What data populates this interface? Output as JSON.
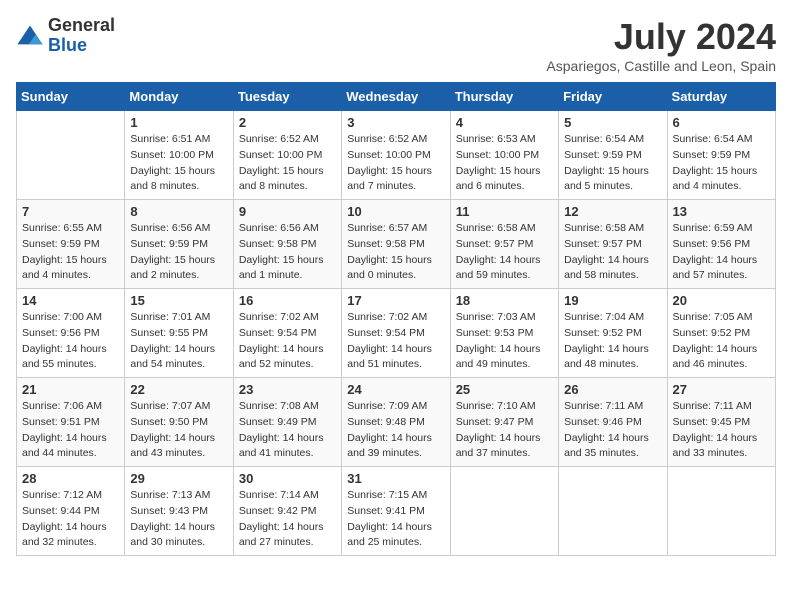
{
  "header": {
    "logo_general": "General",
    "logo_blue": "Blue",
    "month_title": "July 2024",
    "location": "Aspariegos, Castille and Leon, Spain"
  },
  "days_of_week": [
    "Sunday",
    "Monday",
    "Tuesday",
    "Wednesday",
    "Thursday",
    "Friday",
    "Saturday"
  ],
  "weeks": [
    [
      {
        "day": "",
        "info": ""
      },
      {
        "day": "1",
        "info": "Sunrise: 6:51 AM\nSunset: 10:00 PM\nDaylight: 15 hours\nand 8 minutes."
      },
      {
        "day": "2",
        "info": "Sunrise: 6:52 AM\nSunset: 10:00 PM\nDaylight: 15 hours\nand 8 minutes."
      },
      {
        "day": "3",
        "info": "Sunrise: 6:52 AM\nSunset: 10:00 PM\nDaylight: 15 hours\nand 7 minutes."
      },
      {
        "day": "4",
        "info": "Sunrise: 6:53 AM\nSunset: 10:00 PM\nDaylight: 15 hours\nand 6 minutes."
      },
      {
        "day": "5",
        "info": "Sunrise: 6:54 AM\nSunset: 9:59 PM\nDaylight: 15 hours\nand 5 minutes."
      },
      {
        "day": "6",
        "info": "Sunrise: 6:54 AM\nSunset: 9:59 PM\nDaylight: 15 hours\nand 4 minutes."
      }
    ],
    [
      {
        "day": "7",
        "info": "Sunrise: 6:55 AM\nSunset: 9:59 PM\nDaylight: 15 hours\nand 4 minutes."
      },
      {
        "day": "8",
        "info": "Sunrise: 6:56 AM\nSunset: 9:59 PM\nDaylight: 15 hours\nand 2 minutes."
      },
      {
        "day": "9",
        "info": "Sunrise: 6:56 AM\nSunset: 9:58 PM\nDaylight: 15 hours\nand 1 minute."
      },
      {
        "day": "10",
        "info": "Sunrise: 6:57 AM\nSunset: 9:58 PM\nDaylight: 15 hours\nand 0 minutes."
      },
      {
        "day": "11",
        "info": "Sunrise: 6:58 AM\nSunset: 9:57 PM\nDaylight: 14 hours\nand 59 minutes."
      },
      {
        "day": "12",
        "info": "Sunrise: 6:58 AM\nSunset: 9:57 PM\nDaylight: 14 hours\nand 58 minutes."
      },
      {
        "day": "13",
        "info": "Sunrise: 6:59 AM\nSunset: 9:56 PM\nDaylight: 14 hours\nand 57 minutes."
      }
    ],
    [
      {
        "day": "14",
        "info": "Sunrise: 7:00 AM\nSunset: 9:56 PM\nDaylight: 14 hours\nand 55 minutes."
      },
      {
        "day": "15",
        "info": "Sunrise: 7:01 AM\nSunset: 9:55 PM\nDaylight: 14 hours\nand 54 minutes."
      },
      {
        "day": "16",
        "info": "Sunrise: 7:02 AM\nSunset: 9:54 PM\nDaylight: 14 hours\nand 52 minutes."
      },
      {
        "day": "17",
        "info": "Sunrise: 7:02 AM\nSunset: 9:54 PM\nDaylight: 14 hours\nand 51 minutes."
      },
      {
        "day": "18",
        "info": "Sunrise: 7:03 AM\nSunset: 9:53 PM\nDaylight: 14 hours\nand 49 minutes."
      },
      {
        "day": "19",
        "info": "Sunrise: 7:04 AM\nSunset: 9:52 PM\nDaylight: 14 hours\nand 48 minutes."
      },
      {
        "day": "20",
        "info": "Sunrise: 7:05 AM\nSunset: 9:52 PM\nDaylight: 14 hours\nand 46 minutes."
      }
    ],
    [
      {
        "day": "21",
        "info": "Sunrise: 7:06 AM\nSunset: 9:51 PM\nDaylight: 14 hours\nand 44 minutes."
      },
      {
        "day": "22",
        "info": "Sunrise: 7:07 AM\nSunset: 9:50 PM\nDaylight: 14 hours\nand 43 minutes."
      },
      {
        "day": "23",
        "info": "Sunrise: 7:08 AM\nSunset: 9:49 PM\nDaylight: 14 hours\nand 41 minutes."
      },
      {
        "day": "24",
        "info": "Sunrise: 7:09 AM\nSunset: 9:48 PM\nDaylight: 14 hours\nand 39 minutes."
      },
      {
        "day": "25",
        "info": "Sunrise: 7:10 AM\nSunset: 9:47 PM\nDaylight: 14 hours\nand 37 minutes."
      },
      {
        "day": "26",
        "info": "Sunrise: 7:11 AM\nSunset: 9:46 PM\nDaylight: 14 hours\nand 35 minutes."
      },
      {
        "day": "27",
        "info": "Sunrise: 7:11 AM\nSunset: 9:45 PM\nDaylight: 14 hours\nand 33 minutes."
      }
    ],
    [
      {
        "day": "28",
        "info": "Sunrise: 7:12 AM\nSunset: 9:44 PM\nDaylight: 14 hours\nand 32 minutes."
      },
      {
        "day": "29",
        "info": "Sunrise: 7:13 AM\nSunset: 9:43 PM\nDaylight: 14 hours\nand 30 minutes."
      },
      {
        "day": "30",
        "info": "Sunrise: 7:14 AM\nSunset: 9:42 PM\nDaylight: 14 hours\nand 27 minutes."
      },
      {
        "day": "31",
        "info": "Sunrise: 7:15 AM\nSunset: 9:41 PM\nDaylight: 14 hours\nand 25 minutes."
      },
      {
        "day": "",
        "info": ""
      },
      {
        "day": "",
        "info": ""
      },
      {
        "day": "",
        "info": ""
      }
    ]
  ]
}
